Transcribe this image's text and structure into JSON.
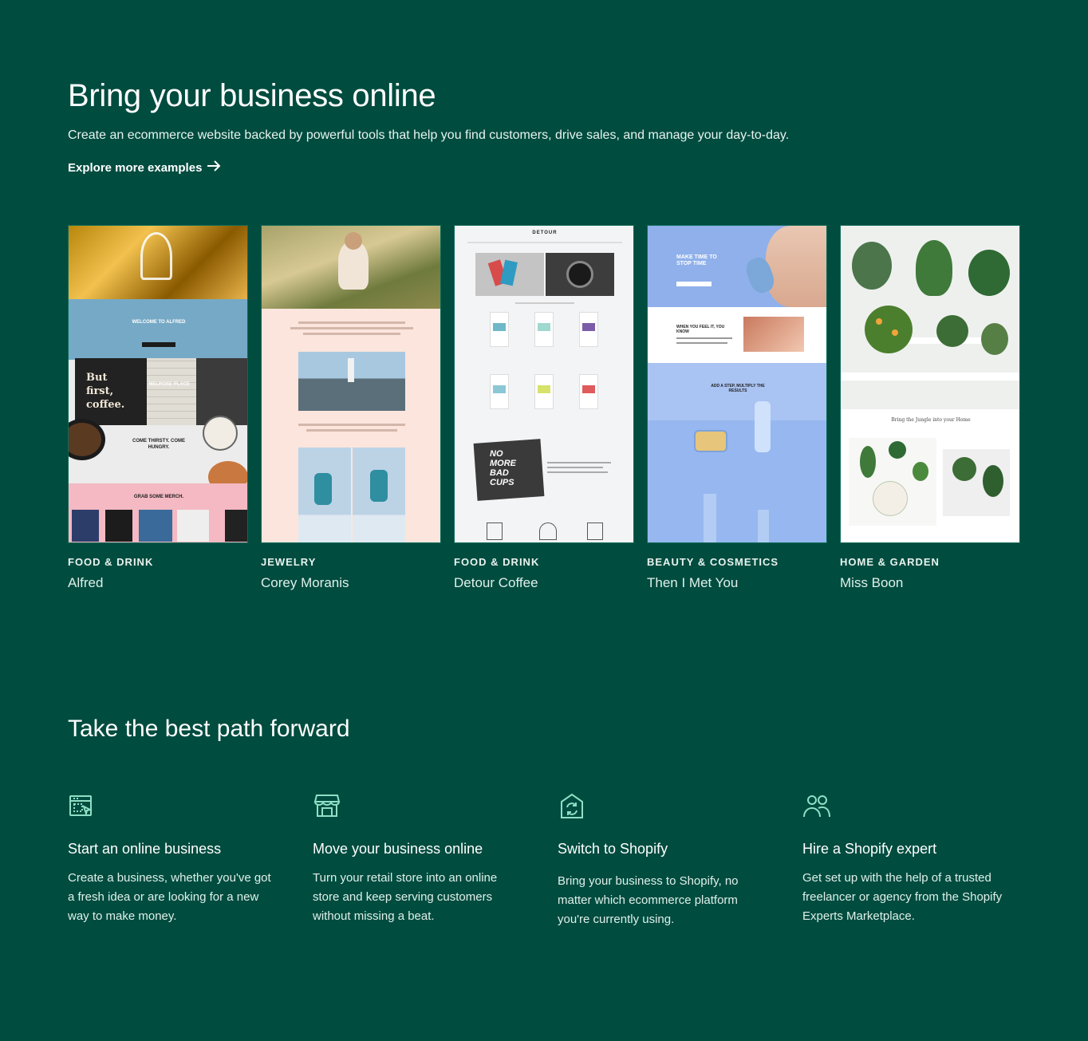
{
  "hero": {
    "title": "Bring your business online",
    "subtitle": "Create an ecommerce website backed by powerful tools that help you find customers, drive sales, and manage your day-to-day.",
    "link_label": "Explore more examples"
  },
  "examples": [
    {
      "category": "FOOD & DRINK",
      "name": "Alfred",
      "thumb_text_1": "WELCOME TO ALFRED",
      "thumb_text_2": "But first, coffee.",
      "thumb_text_3": "MELROSE PLACE",
      "thumb_text_4": "COME THIRSTY. COME HUNGRY.",
      "thumb_text_5": "GRAB SOME MERCH."
    },
    {
      "category": "JEWELRY",
      "name": "Corey Moranis"
    },
    {
      "category": "FOOD & DRINK",
      "name": "Detour Coffee",
      "thumb_text_1": "DETOUR",
      "thumb_text_2": "NO MORE BAD CUPS"
    },
    {
      "category": "BEAUTY & COSMETICS",
      "name": "Then I Met You",
      "thumb_text_1": "MAKE TIME TO STOP TIME",
      "thumb_text_2": "WHEN YOU FEEL IT, YOU KNOW",
      "thumb_text_3": "ADD A STEP, MULTIPLY THE RESULTS"
    },
    {
      "category": "HOME & GARDEN",
      "name": "Miss Boon",
      "thumb_text_1": "Bring the Jungle into your Home"
    }
  ],
  "paths": {
    "title": "Take the best path forward",
    "items": [
      {
        "icon": "store-builder-icon",
        "heading": "Start an online business",
        "description": "Create a business, whether you've got a fresh idea or are looking for a new way to make money."
      },
      {
        "icon": "storefront-icon",
        "heading": "Move your business online",
        "description": "Turn your retail store into an online store and keep serving customers without missing a beat."
      },
      {
        "icon": "switch-store-icon",
        "heading": "Switch to Shopify",
        "description": "Bring your business to Shopify, no matter which ecommerce platform you're currently using."
      },
      {
        "icon": "people-icon",
        "heading": "Hire a Shopify expert",
        "description": "Get set up with the help of a trusted freelancer or agency from the Shopify Experts Marketplace."
      }
    ]
  },
  "colors": {
    "background": "#004c3f",
    "text": "#ffffff",
    "icon_accent": "#8ee0c6"
  }
}
